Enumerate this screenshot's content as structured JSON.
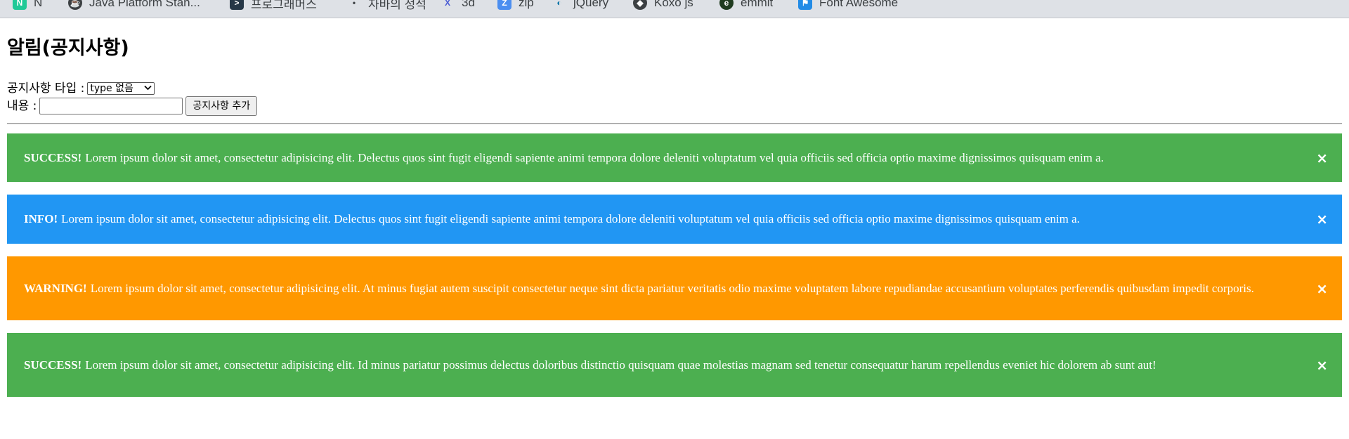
{
  "bookmarks": [
    {
      "label": "N",
      "icon": "notion-icon",
      "color": "#20c997",
      "glyph": "N"
    },
    {
      "label": "Java Platform Stan...",
      "icon": "java-icon",
      "color": "#3c4043",
      "glyph": "☕"
    },
    {
      "label": "프로그래머스",
      "icon": "programmers-icon",
      "color": "#263747",
      "glyph": ">"
    },
    {
      "label": "자바의 정석",
      "icon": "dot-icon",
      "color": "#3c4043",
      "glyph": "•"
    },
    {
      "label": "3d",
      "icon": "x-logo-icon",
      "color": "#4a5bd4",
      "glyph": "X"
    },
    {
      "label": "zip",
      "icon": "zoom-icon",
      "color": "#4b8ef0",
      "glyph": "Z"
    },
    {
      "label": "jQuery",
      "icon": "jquery-icon",
      "color": "#0e76a8",
      "glyph": "◐"
    },
    {
      "label": "Koxo js",
      "icon": "koxo-icon",
      "color": "#3c4043",
      "glyph": "◆"
    },
    {
      "label": "emmit",
      "icon": "emmet-icon",
      "color": "#1f3b1f",
      "glyph": "e"
    },
    {
      "label": "Font Awesome",
      "icon": "font-awesome-icon",
      "color": "#228be6",
      "glyph": "⚑"
    }
  ],
  "page": {
    "title": "알림(공지사항)"
  },
  "form": {
    "type_label": "공지사항 타입 :",
    "type_selected": "type 없음",
    "content_label": "내용 :",
    "content_value": "",
    "add_button": "공지사항 추가"
  },
  "alerts": [
    {
      "kind": "SUCCESS!",
      "text": "Lorem ipsum dolor sit amet, consectetur adipisicing elit. Delectus quos sint fugit eligendi sapiente animi tempora dolore deleniti voluptatum vel quia officiis sed officia optio maxime dignissimos quisquam enim a.",
      "color": "#4caf50",
      "close": "×"
    },
    {
      "kind": "INFO!",
      "text": "Lorem ipsum dolor sit amet, consectetur adipisicing elit. Delectus quos sint fugit eligendi sapiente animi tempora dolore deleniti voluptatum vel quia officiis sed officia optio maxime dignissimos quisquam enim a.",
      "color": "#2196f3",
      "close": "×"
    },
    {
      "kind": "WARNING!",
      "text": "Lorem ipsum dolor sit amet, consectetur adipisicing elit. At minus fugiat autem suscipit consectetur neque sint dicta pariatur veritatis odio maxime voluptatem labore repudiandae accusantium voluptates perferendis quibusdam impedit corporis.",
      "color": "#ff9800",
      "close": "×"
    },
    {
      "kind": "SUCCESS!",
      "text": "Lorem ipsum dolor sit amet, consectetur adipisicing elit. Id minus pariatur possimus delectus doloribus distinctio quisquam quae molestias magnam sed tenetur consequatur harum repellendus eveniet hic dolorem ab sunt aut!",
      "color": "#4caf50",
      "close": "×"
    }
  ]
}
